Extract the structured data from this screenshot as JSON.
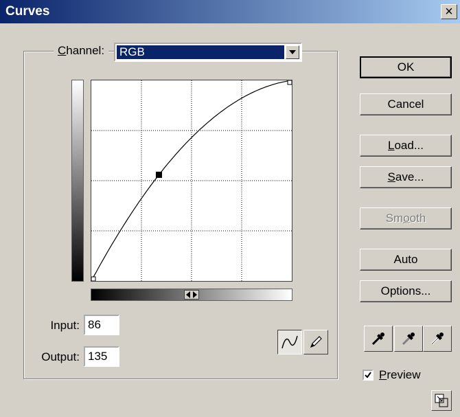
{
  "window": {
    "title": "Curves",
    "close_glyph": "×"
  },
  "channel": {
    "label_mnemonic": "C",
    "label_rest": "hannel:",
    "value": "RGB"
  },
  "curve": {
    "domain": [
      0,
      255
    ],
    "points": [
      [
        0,
        0
      ],
      [
        86,
        135
      ],
      [
        255,
        255
      ]
    ],
    "grid_divisions": 4
  },
  "fields": {
    "input_label": "Input:",
    "input_value": "86",
    "output_label": "Output:",
    "output_value": "135"
  },
  "tools": {
    "curve_tool": "curve-icon",
    "pencil_tool": "pencil-icon",
    "active": "curve"
  },
  "buttons": [
    {
      "id": "ok",
      "label": "OK",
      "default": true,
      "disabled": false
    },
    {
      "id": "cancel",
      "label": "Cancel",
      "default": false,
      "disabled": false
    },
    {
      "id": "load",
      "mnemonic": "L",
      "rest": "oad...",
      "default": false,
      "disabled": false
    },
    {
      "id": "save",
      "mnemonic": "S",
      "rest": "ave...",
      "default": false,
      "disabled": false
    },
    {
      "id": "smooth",
      "pre": "Sm",
      "mnemonic": "o",
      "rest": "oth",
      "disabled": true
    },
    {
      "id": "auto",
      "label": "Auto",
      "default": false,
      "disabled": false
    },
    {
      "id": "options",
      "label": "Options...",
      "default": false,
      "disabled": false
    }
  ],
  "eyedroppers": [
    "black-eyedropper-icon",
    "gray-eyedropper-icon",
    "white-eyedropper-icon"
  ],
  "preview": {
    "mnemonic": "P",
    "rest": "review",
    "checked": true
  },
  "colors": {
    "title_start": "#0a246a",
    "title_end": "#a6caf0",
    "dialog_bg": "#d4d0c8",
    "selection": "#0a246a"
  }
}
